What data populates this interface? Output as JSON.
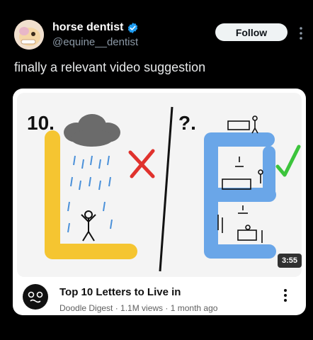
{
  "post": {
    "display_name": "horse dentist",
    "handle": "@equine__dentist",
    "follow_label": "Follow",
    "text": "finally a relevant video suggestion"
  },
  "video": {
    "title": "Top 10 Letters to Live in",
    "meta": "Doodle Digest · 1.1M views · 1 month ago",
    "duration": "3:55",
    "thumbnail": {
      "left_rank": "10.",
      "right_rank": "?.",
      "left_letter": "L",
      "right_letter": "E",
      "left_mark": "x-mark",
      "right_mark": "check-mark"
    }
  },
  "colors": {
    "background": "#000000",
    "verified_blue": "#1d9bf0",
    "letter_yellow": "#f5c531",
    "letter_blue": "#6aa6e8",
    "cross_red": "#e0322d",
    "check_green": "#3cc43c"
  }
}
